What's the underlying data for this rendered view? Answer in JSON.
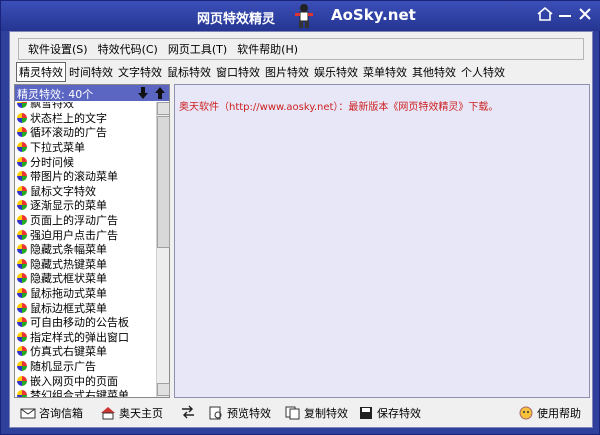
{
  "window": {
    "title": "网页特效精灵",
    "brand": "AoSky.net"
  },
  "menubar": {
    "items": [
      {
        "label": "软件设置(S)"
      },
      {
        "label": "特效代码(C)"
      },
      {
        "label": "网页工具(T)"
      },
      {
        "label": "软件帮助(H)"
      }
    ]
  },
  "tabs": [
    {
      "label": "精灵特效",
      "active": true
    },
    {
      "label": "时间特效"
    },
    {
      "label": "文字特效"
    },
    {
      "label": "鼠标特效"
    },
    {
      "label": "窗口特效"
    },
    {
      "label": "图片特效"
    },
    {
      "label": "娱乐特效"
    },
    {
      "label": "菜单特效"
    },
    {
      "label": "其他特效"
    },
    {
      "label": "个人特效"
    }
  ],
  "effect_list": {
    "header": "精灵特效: 40个",
    "items": [
      "飘雪特效",
      "状态栏上的文字",
      "循环滚动的广告",
      "下拉式菜单",
      "分时问候",
      "带图片的滚动菜单",
      "鼠标文字特效",
      "逐渐显示的菜单",
      "页面上的浮动广告",
      "强迫用户点击广告",
      "隐藏式条幅菜单",
      "隐藏式热键菜单",
      "隐藏式框状菜单",
      "鼠标拖动式菜单",
      "鼠标边框式菜单",
      "可自由移动的公告板",
      "指定样式的弹出窗口",
      "仿真式右键菜单",
      "随机显示广告",
      "嵌入网页中的页面",
      "梦幻组合式右键菜单"
    ]
  },
  "info_text": "奥天软件（http://www.aosky.net）：最新版本《网页特效精灵》下载。",
  "bottom_toolbar": {
    "feedback": "咨询信箱",
    "homepage": "奥天主页",
    "preview": "预览特效",
    "copy": "复制特效",
    "save": "保存特效",
    "help": "使用帮助"
  },
  "colors": {
    "titlebar": "#2f3f9c",
    "list_header": "#5b66c3",
    "content_bg": "#e8e7f7",
    "info_text": "#cc2020"
  }
}
